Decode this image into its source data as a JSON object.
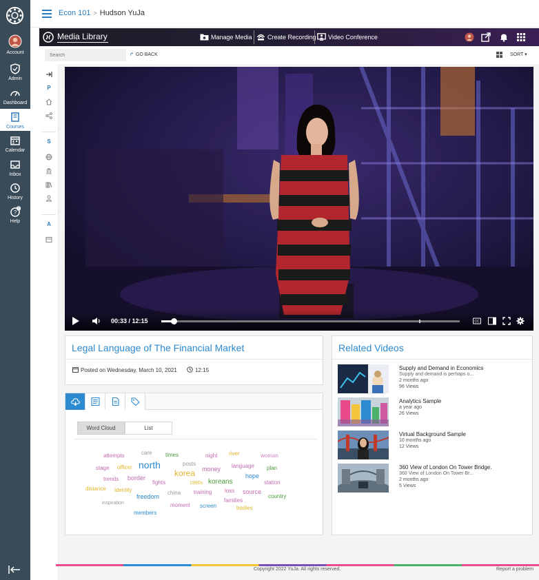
{
  "global_nav": {
    "items": [
      {
        "label": "Account",
        "icon": "avatar"
      },
      {
        "label": "Admin",
        "icon": "shield-icon"
      },
      {
        "label": "Dashboard",
        "icon": "dashboard-icon"
      },
      {
        "label": "Courses",
        "icon": "book-icon",
        "active": true
      },
      {
        "label": "Calendar",
        "icon": "calendar-icon"
      },
      {
        "label": "Inbox",
        "icon": "inbox-icon"
      },
      {
        "label": "History",
        "icon": "clock-icon"
      },
      {
        "label": "Help",
        "icon": "help-icon",
        "badge": "7"
      }
    ]
  },
  "header": {
    "breadcrumb": {
      "course": "Econ 101",
      "current": "Hudson YuJa"
    }
  },
  "yuja": {
    "app_title": "Media Library",
    "nav": {
      "manage_media": "Manage Media",
      "create_recording": "Create Recording",
      "video_conference": "Video Conference"
    },
    "toolbar": {
      "search_placeholder": "Search",
      "go_back": "GO BACK",
      "sort": "SORT ▾"
    },
    "rail": {
      "section_p": "P",
      "section_s": "S",
      "section_a": "A"
    }
  },
  "player": {
    "time": "00:33 / 12:15",
    "progress": 0.042,
    "chapter_marker": 0.864
  },
  "media": {
    "title": "Legal Language of The Financial Market",
    "posted": "Posted on Wednesday, March 10, 2021",
    "duration": "12:15"
  },
  "cloud_panel": {
    "tabs": [
      "word-cloud-tab",
      "transcript-tab",
      "document-tab",
      "tags-tab"
    ],
    "view_wordcloud": "Word Cloud",
    "view_list": "List",
    "words": [
      {
        "t": "attempts",
        "c": "#c46bb3"
      },
      {
        "t": "care",
        "c": "#999999"
      },
      {
        "t": "times",
        "c": "#4a9c3a"
      },
      {
        "t": "night",
        "c": "#c46bb3"
      },
      {
        "t": "river",
        "c": "#e2b52a"
      },
      {
        "t": "woman",
        "c": "#d184c9"
      },
      {
        "t": "stage",
        "c": "#c46bb3"
      },
      {
        "t": "officer",
        "c": "#e2b52a"
      },
      {
        "t": "north",
        "c": "#2b8ad0"
      },
      {
        "t": "posts",
        "c": "#999999"
      },
      {
        "t": "money",
        "c": "#c46bb3"
      },
      {
        "t": "language",
        "c": "#c46bb3"
      },
      {
        "t": "plan",
        "c": "#4a9c3a"
      },
      {
        "t": "korea",
        "c": "#e2b52a"
      },
      {
        "t": "trends",
        "c": "#c46bb3"
      },
      {
        "t": "border",
        "c": "#c46bb3"
      },
      {
        "t": "1990s",
        "c": "#e2b52a"
      },
      {
        "t": "koreans",
        "c": "#4a9c3a"
      },
      {
        "t": "hope",
        "c": "#2b8ad0"
      },
      {
        "t": "fights",
        "c": "#c46bb3"
      },
      {
        "t": "station",
        "c": "#c46bb3"
      },
      {
        "t": "distance",
        "c": "#e2b52a"
      },
      {
        "t": "identity",
        "c": "#e2b52a"
      },
      {
        "t": "china",
        "c": "#999999"
      },
      {
        "t": "training",
        "c": "#c46bb3"
      },
      {
        "t": "loss",
        "c": "#c46bb3"
      },
      {
        "t": "source",
        "c": "#c46bb3"
      },
      {
        "t": "freedom",
        "c": "#2b8ad0"
      },
      {
        "t": "families",
        "c": "#c46bb3"
      },
      {
        "t": "country",
        "c": "#4a9c3a"
      },
      {
        "t": "inspiration",
        "c": "#999999"
      },
      {
        "t": "moment",
        "c": "#c46bb3"
      },
      {
        "t": "screen",
        "c": "#2b8ad0"
      },
      {
        "t": "bodies",
        "c": "#e2b52a"
      },
      {
        "t": "members",
        "c": "#2b8ad0"
      }
    ]
  },
  "related": {
    "heading": "Related Videos",
    "items": [
      {
        "title": "Supply and Demand in Economics",
        "desc": "Supply and demand is perhaps o...",
        "date": "2 months ago",
        "views": "96 Views"
      },
      {
        "title": "Analytics Sample",
        "desc": "",
        "date": "a year ago",
        "views": "26 Views"
      },
      {
        "title": "Virtual Background Sample",
        "desc": "",
        "date": "10 months ago",
        "views": "12 Views"
      },
      {
        "title": "360 View of London On Tower Bridge.",
        "desc": "360 View of London On Tower Br...",
        "date": "2 months ago",
        "views": "5 Views"
      }
    ]
  },
  "footer": {
    "copyright": "Copyright 2022 YuJa. All rights reserved.",
    "report": "Report a problem"
  }
}
